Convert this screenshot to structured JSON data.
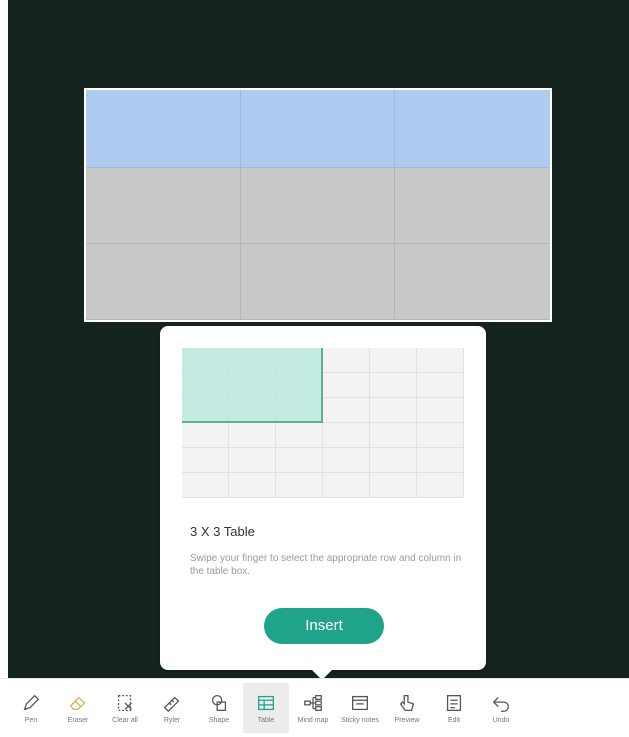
{
  "popup": {
    "title": "3 X 3 Table",
    "description": "Swipe your finger to select the appropriate row and column in the table box.",
    "insert_label": "Insert"
  },
  "toolbar": {
    "items": [
      {
        "label": "Pen",
        "icon": "pen-icon"
      },
      {
        "label": "Eraser",
        "icon": "eraser-icon"
      },
      {
        "label": "Clear all",
        "icon": "clear-all-icon"
      },
      {
        "label": "Ryler",
        "icon": "ruler-icon"
      },
      {
        "label": "Shape",
        "icon": "shape-icon"
      },
      {
        "label": "Table",
        "icon": "table-icon",
        "active": true
      },
      {
        "label": "Mind map",
        "icon": "mind-map-icon"
      },
      {
        "label": "Sticky notes",
        "icon": "sticky-notes-icon"
      },
      {
        "label": "Preview",
        "icon": "preview-icon"
      },
      {
        "label": "Edit",
        "icon": "edit-icon"
      },
      {
        "label": "Undo",
        "icon": "undo-icon"
      }
    ]
  },
  "colors": {
    "board_background": "#16241f",
    "table_header": "#b0cbf2",
    "table_body": "#c9c9c9",
    "selection": "#b4e8db",
    "accent": "#1fa38a",
    "eraser_icon": "#d9b24c"
  }
}
